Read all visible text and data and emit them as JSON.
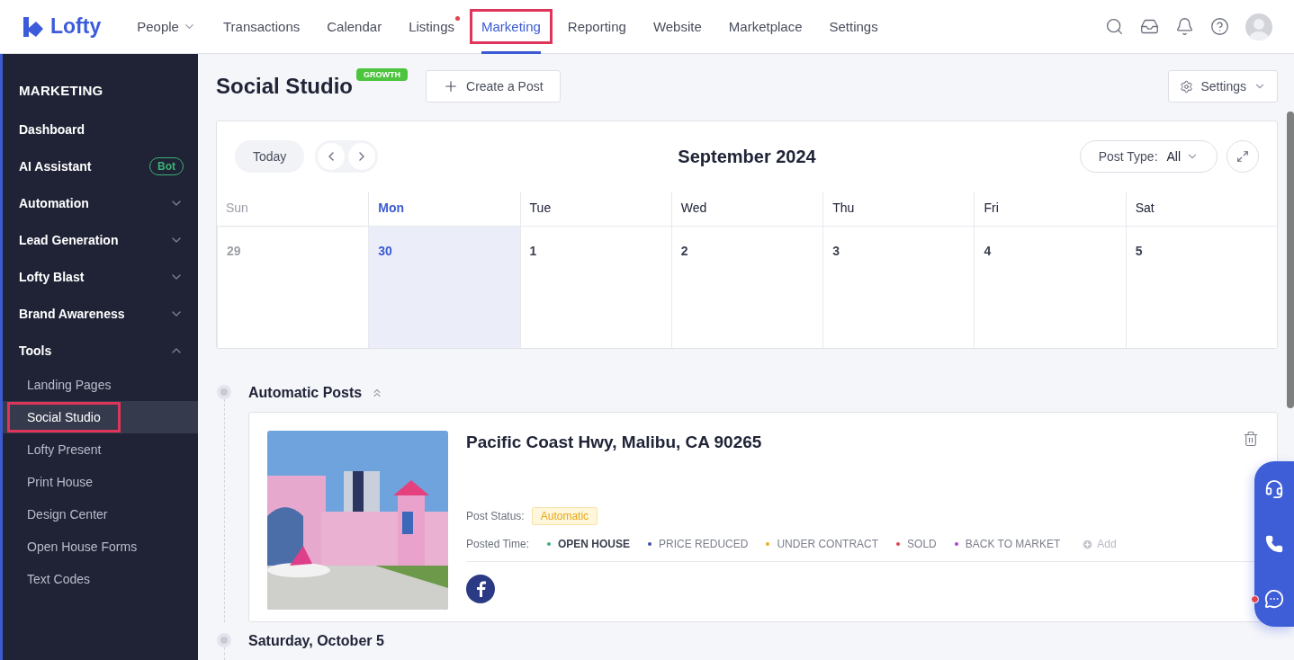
{
  "logo": {
    "text": "Lofty"
  },
  "nav": [
    {
      "label": "People",
      "dropdown": true,
      "dot": false,
      "selected": false
    },
    {
      "label": "Transactions",
      "dropdown": false,
      "dot": false,
      "selected": false
    },
    {
      "label": "Calendar",
      "dropdown": false,
      "dot": false,
      "selected": false
    },
    {
      "label": "Listings",
      "dropdown": false,
      "dot": true,
      "selected": false
    },
    {
      "label": "Marketing",
      "dropdown": false,
      "dot": false,
      "selected": true
    },
    {
      "label": "Reporting",
      "dropdown": false,
      "dot": false,
      "selected": false
    },
    {
      "label": "Website",
      "dropdown": false,
      "dot": false,
      "selected": false
    },
    {
      "label": "Marketplace",
      "dropdown": false,
      "dot": false,
      "selected": false
    },
    {
      "label": "Settings",
      "dropdown": false,
      "dot": false,
      "selected": false
    }
  ],
  "sidebar": {
    "title": "MARKETING",
    "items": [
      {
        "label": "Dashboard",
        "kind": "link"
      },
      {
        "label": "AI Assistant",
        "kind": "link",
        "badge": "Bot"
      },
      {
        "label": "Automation",
        "kind": "group",
        "expanded": false
      },
      {
        "label": "Lead Generation",
        "kind": "group",
        "expanded": false
      },
      {
        "label": "Lofty Blast",
        "kind": "group",
        "expanded": false
      },
      {
        "label": "Brand Awareness",
        "kind": "group",
        "expanded": false
      },
      {
        "label": "Tools",
        "kind": "group",
        "expanded": true,
        "children": [
          {
            "label": "Landing Pages",
            "selected": false
          },
          {
            "label": "Social Studio",
            "selected": true
          },
          {
            "label": "Lofty Present",
            "selected": false
          },
          {
            "label": "Print House",
            "selected": false
          },
          {
            "label": "Design Center",
            "selected": false
          },
          {
            "label": "Open House Forms",
            "selected": false
          },
          {
            "label": "Text Codes",
            "selected": false
          }
        ]
      }
    ]
  },
  "page": {
    "title": "Social Studio",
    "badge": "GROWTH",
    "create_button": "Create a Post",
    "settings_button": "Settings"
  },
  "calendar": {
    "today_button": "Today",
    "month": "September 2024",
    "post_type_label": "Post Type:",
    "post_type_value": "All",
    "days": [
      {
        "weekday": "Sun",
        "date": "29",
        "selected": false,
        "outside": true
      },
      {
        "weekday": "Mon",
        "date": "30",
        "selected": true,
        "outside": false
      },
      {
        "weekday": "Tue",
        "date": "1",
        "selected": false,
        "outside": false
      },
      {
        "weekday": "Wed",
        "date": "2",
        "selected": false,
        "outside": false
      },
      {
        "weekday": "Thu",
        "date": "3",
        "selected": false,
        "outside": false
      },
      {
        "weekday": "Fri",
        "date": "4",
        "selected": false,
        "outside": false
      },
      {
        "weekday": "Sat",
        "date": "5",
        "selected": false,
        "outside": false
      }
    ]
  },
  "sections": [
    {
      "title": "Automatic Posts",
      "expanded": true,
      "posts": [
        {
          "address": "Pacific Coast Hwy, Malibu, CA 90265",
          "status_label": "Post Status:",
          "status": "Automatic",
          "time_label": "Posted Time:",
          "tags": [
            {
              "label": "OPEN HOUSE",
              "color": "#3bb273",
              "selected": true
            },
            {
              "label": "PRICE REDUCED",
              "color": "#3c4fb5",
              "selected": false
            },
            {
              "label": "UNDER CONTRACT",
              "color": "#f0a81e",
              "selected": false
            },
            {
              "label": "SOLD",
              "color": "#e0434f",
              "selected": false
            },
            {
              "label": "BACK TO MARKET",
              "color": "#a544d6",
              "selected": false
            }
          ],
          "add_label": "Add"
        }
      ]
    },
    {
      "title": "Saturday, October 5"
    }
  ]
}
